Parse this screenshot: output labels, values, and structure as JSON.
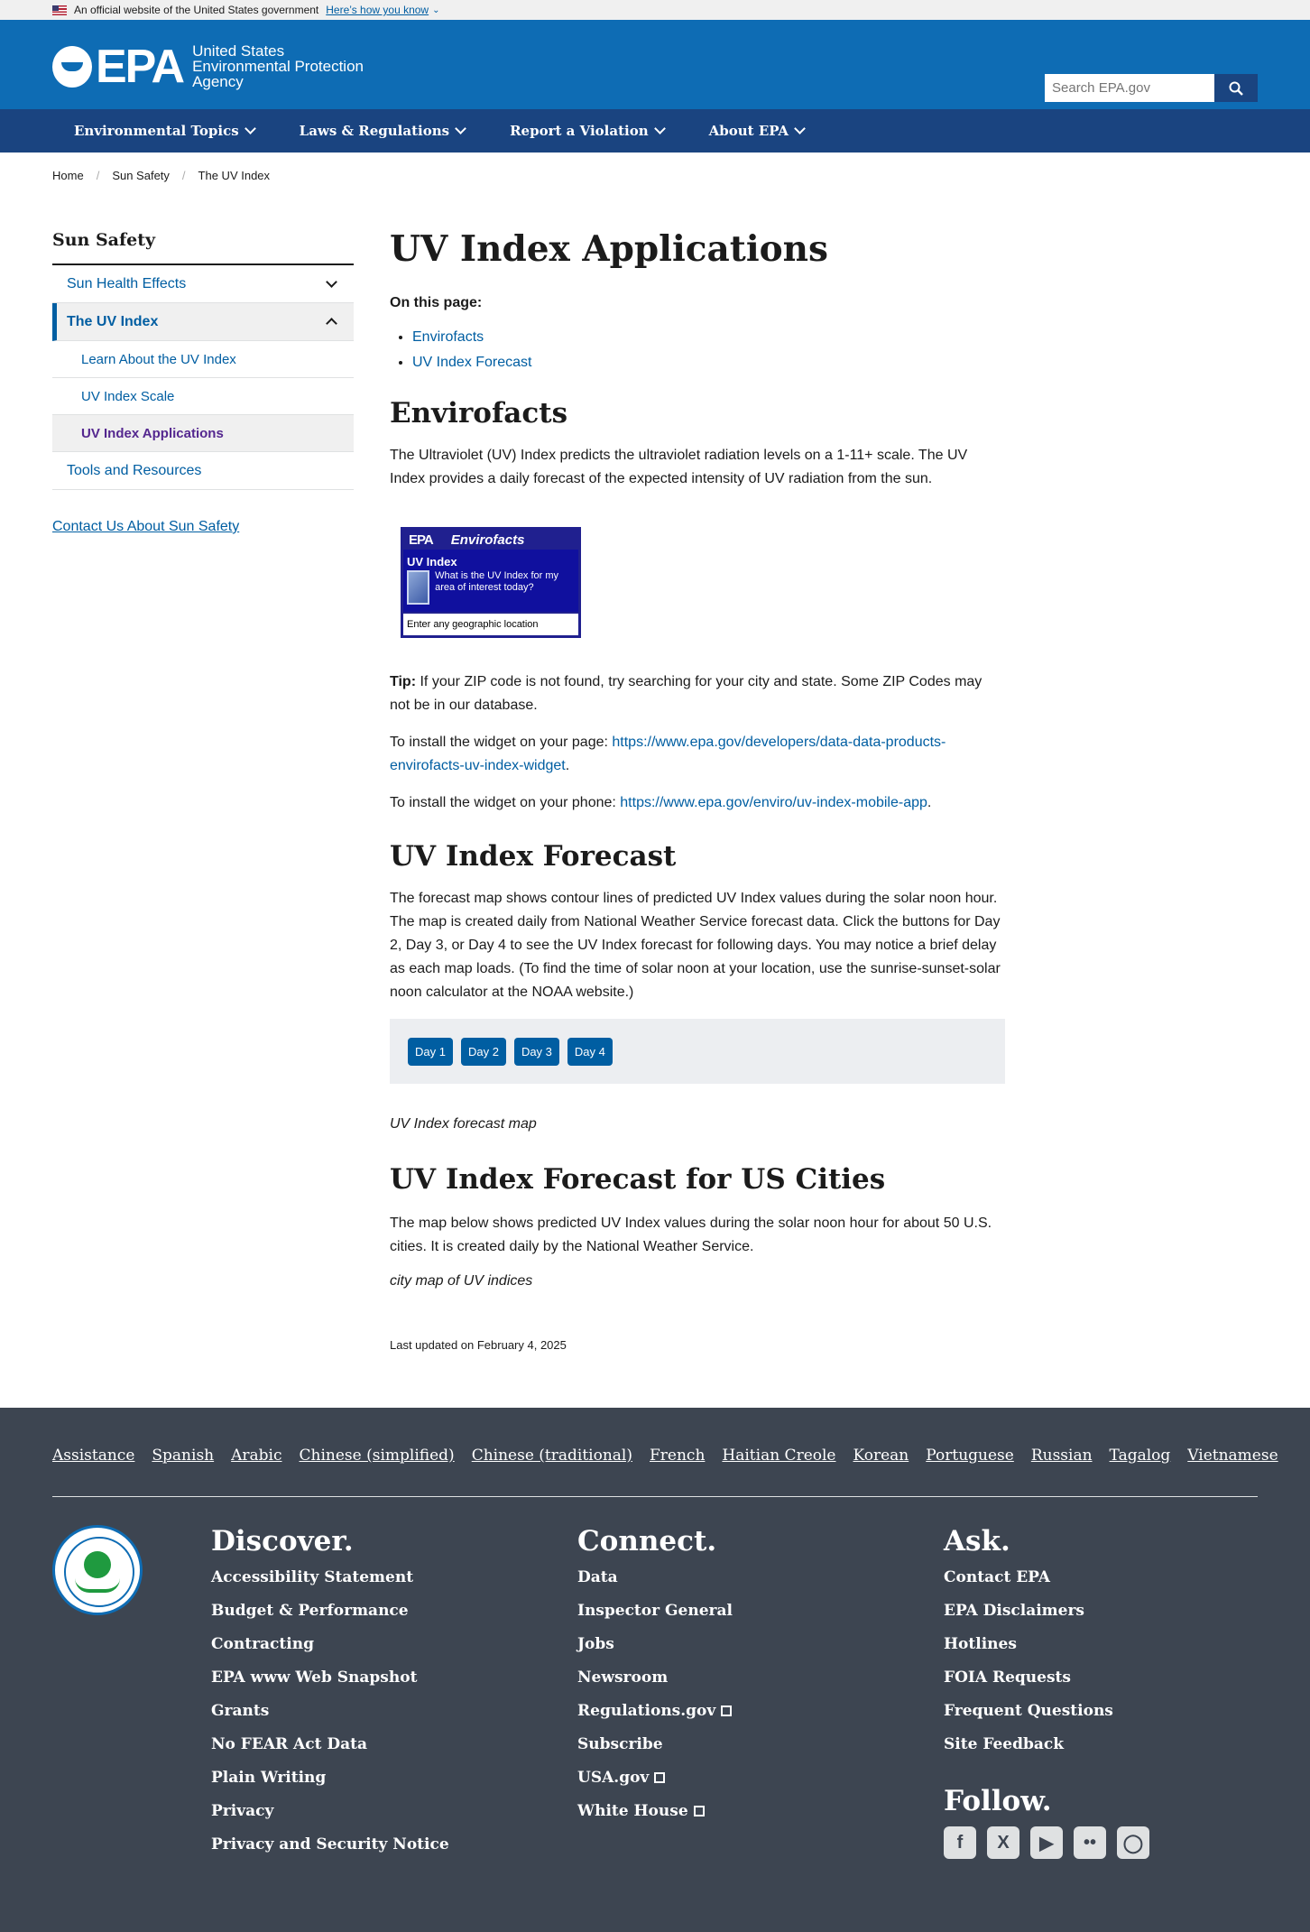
{
  "gov_banner": {
    "text": "An official website of the United States government",
    "link": "Here’s how you know"
  },
  "header": {
    "logo_text": "EPA",
    "agency_line1": "United States",
    "agency_line2": "Environmental Protection",
    "agency_line3": "Agency",
    "search_placeholder": "Search EPA.gov"
  },
  "nav": [
    "Environmental Topics",
    "Laws & Regulations",
    "Report a Violation",
    "About EPA"
  ],
  "breadcrumb": [
    "Home",
    "Sun Safety",
    "The UV Index"
  ],
  "sidebar": {
    "title": "Sun Safety",
    "item1": "Sun Health Effects",
    "item2": "The UV Index",
    "sub1": "Learn About the UV Index",
    "sub2": "UV Index Scale",
    "sub3": "UV Index Applications",
    "item3": "Tools and Resources",
    "contact": "Contact Us About Sun Safety"
  },
  "main": {
    "title": "UV Index Applications",
    "on_this_page": "On this page:",
    "toc1": "Envirofacts",
    "toc2": "UV Index Forecast",
    "envirofacts_heading": "Envirofacts",
    "envirofacts_text": "The Ultraviolet (UV) Index predicts the ultraviolet radiation levels on a 1-11+ scale. The UV Index provides a daily forecast of the expected intensity of UV radiation from the sun.",
    "widget": {
      "epa": "EPA",
      "brand": "Envirofacts",
      "title": "UV Index",
      "question": "What is the UV Index for my area of interest today?",
      "input": "Enter any geographic location"
    },
    "tip_label": "Tip:",
    "tip_text": " If your ZIP code is not found, try searching for your city and state. Some ZIP Codes may not be in our database.",
    "install_page_label": "To install the widget on your page: ",
    "install_page_link": "https://www.epa.gov/developers/data-data-products-envirofacts-uv-index-widget",
    "install_phone_label": "To install the widget on your phone: ",
    "install_phone_link": "https://www.epa.gov/enviro/uv-index-mobile-app",
    "forecast_heading": "UV Index Forecast",
    "forecast_text": "The forecast map shows contour lines of predicted UV Index values during the solar noon hour. The map is created daily from National Weather Service forecast data. Click the buttons for Day 2, Day 3, or Day 4 to see the UV Index forecast for following days. You may notice a brief delay as each map loads. (To find the time of solar noon at your location, use the sunrise-sunset-solar noon calculator at the NOAA website.)",
    "days": [
      "Day 1",
      "Day 2",
      "Day 3",
      "Day 4"
    ],
    "forecast_map_caption": "UV Index forecast map",
    "cities_heading": "UV Index Forecast for US Cities",
    "cities_text": "The map below shows predicted UV Index values during the solar noon hour for about 50 U.S. cities. It is created daily by the National Weather Service.",
    "cities_caption": "city map of UV indices",
    "updated": "Last updated on February 4, 2025"
  },
  "footer": {
    "languages": [
      "Assistance",
      "Spanish",
      "Arabic",
      "Chinese (simplified)",
      "Chinese (traditional)",
      "French",
      "Haitian Creole",
      "Korean",
      "Portuguese",
      "Russian",
      "Tagalog",
      "Vietnamese"
    ],
    "discover_title": "Discover.",
    "discover": [
      "Accessibility Statement",
      "Budget & Performance",
      "Contracting",
      "EPA www Web Snapshot",
      "Grants",
      "No FEAR Act Data",
      "Plain Writing",
      "Privacy",
      "Privacy and Security Notice"
    ],
    "connect_title": "Connect.",
    "connect": [
      "Data",
      "Inspector General",
      "Jobs",
      "Newsroom",
      "Regulations.gov",
      "Subscribe",
      "USA.gov",
      "White House"
    ],
    "ask_title": "Ask.",
    "ask": [
      "Contact EPA",
      "EPA Disclaimers",
      "Hotlines",
      "FOIA Requests",
      "Frequent Questions",
      "Site Feedback"
    ],
    "follow_title": "Follow.",
    "social_icons": [
      "facebook-icon",
      "x-icon",
      "youtube-icon",
      "flickr-icon",
      "instagram-icon"
    ]
  }
}
